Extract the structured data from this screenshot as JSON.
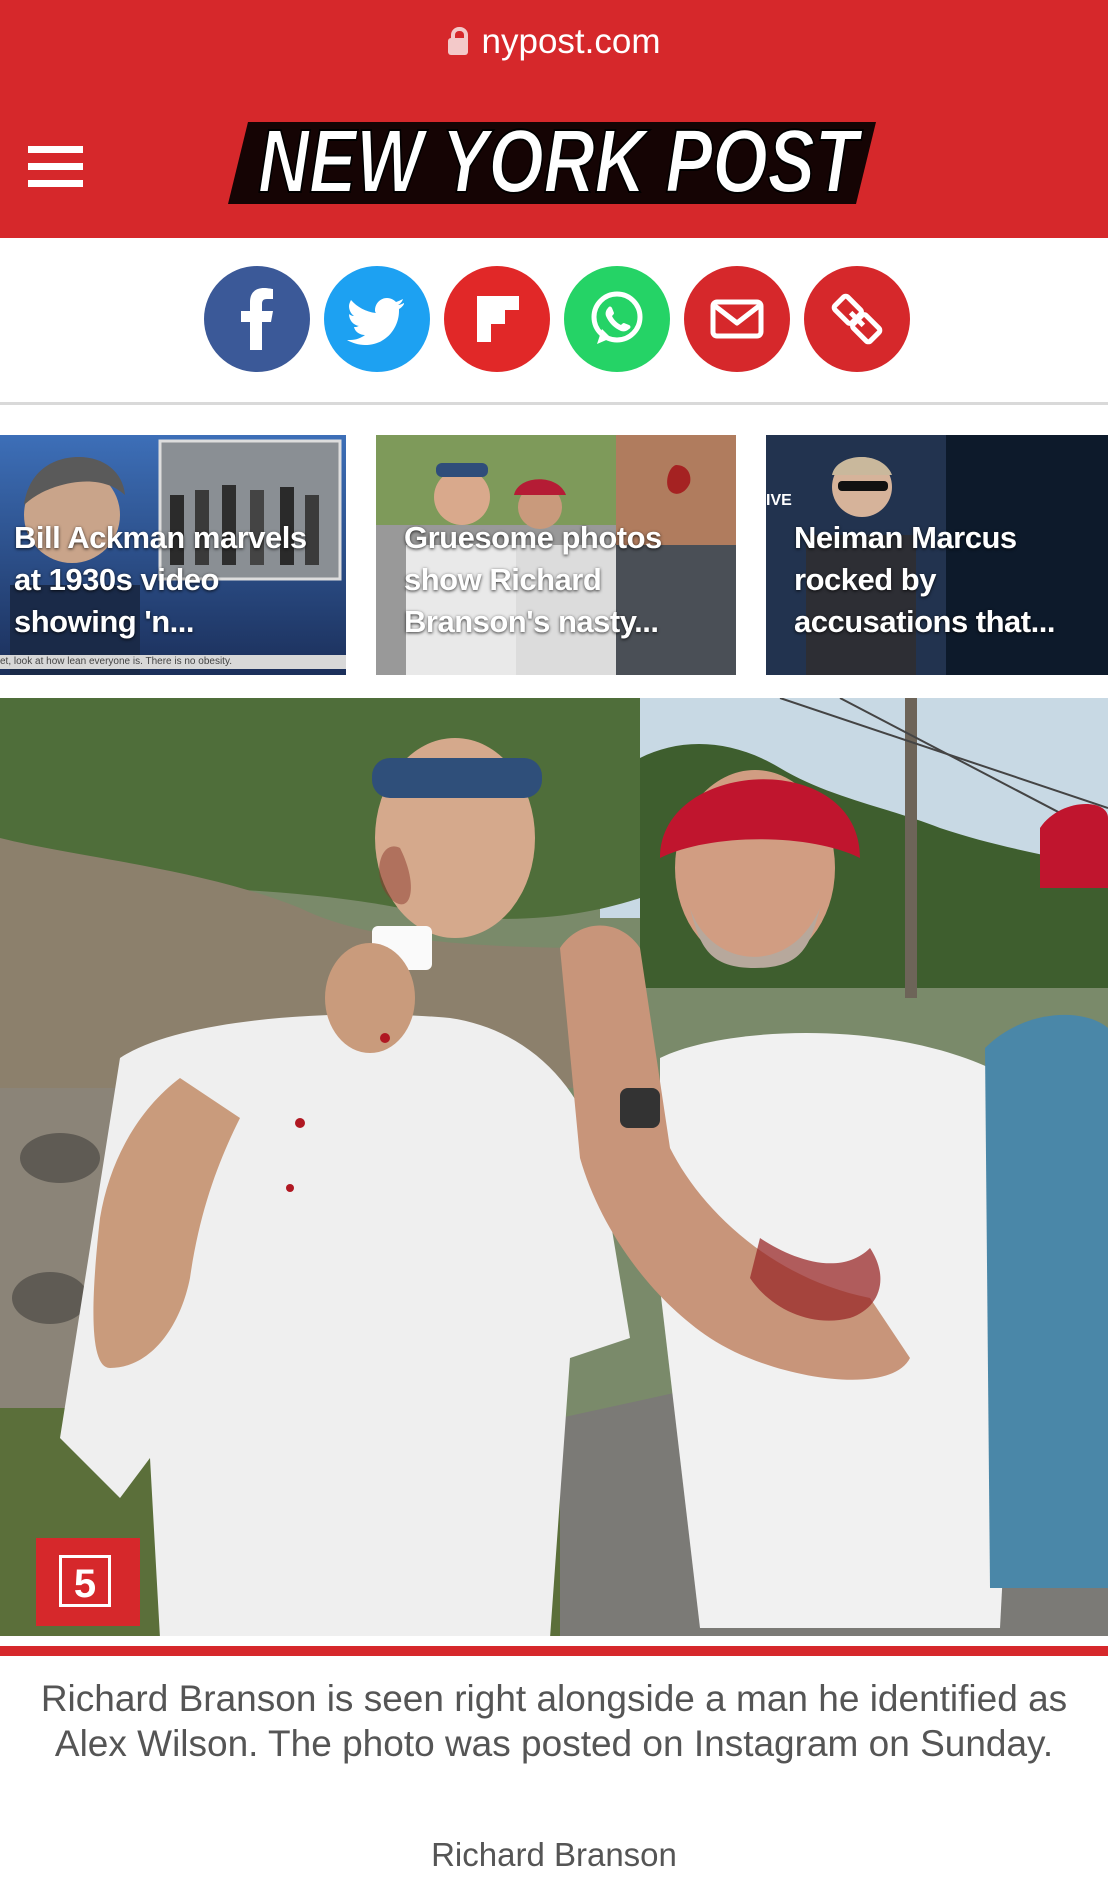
{
  "browser": {
    "url": "nypost.com"
  },
  "header": {
    "logo_text": "NEW YORK POST",
    "menu_icon": "hamburger-icon"
  },
  "colors": {
    "brand_red": "#d6282b",
    "facebook": "#3b5998",
    "twitter": "#1da1f2",
    "flipboard": "#e12828",
    "whatsapp": "#25d366",
    "email": "#d6282b",
    "link": "#d6282b"
  },
  "share": [
    {
      "name": "facebook",
      "icon": "facebook-icon"
    },
    {
      "name": "twitter",
      "icon": "twitter-icon"
    },
    {
      "name": "flipboard",
      "icon": "flipboard-icon"
    },
    {
      "name": "whatsapp",
      "icon": "whatsapp-icon"
    },
    {
      "name": "email",
      "icon": "email-icon"
    },
    {
      "name": "copy-link",
      "icon": "link-icon"
    }
  ],
  "related": [
    {
      "title": "Bill Ackman marvels at 1930s video showing 'n...",
      "strip": "et, look at how lean everyone is. There is no obesity."
    },
    {
      "title": "Gruesome photos show Richard Branson's nasty..."
    },
    {
      "title": "Neiman Marcus rocked by accusations that..."
    }
  ],
  "article": {
    "photo_count": "5",
    "caption": "Richard Branson is seen right alongside a man he identified as Alex Wilson. The photo was posted on Instagram on Sunday.",
    "credit": "Richard Branson"
  }
}
